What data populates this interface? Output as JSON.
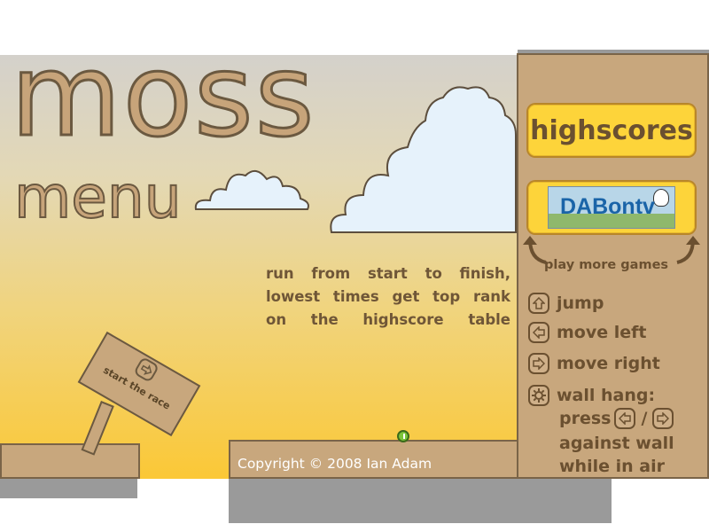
{
  "game": {
    "title": "moss",
    "subtitle": "menu"
  },
  "instructions": {
    "lines": [
      "run from start to finish,",
      "lowest times get top rank",
      "on the highscore table"
    ]
  },
  "sign": {
    "label": "start the race"
  },
  "copyright": "Copyright © 2008 Ian Adam",
  "sidebar": {
    "highscores_label": "highscores",
    "sponsor_label": "DABontv",
    "play_more_label": "play more games"
  },
  "controls": {
    "jump": "jump",
    "move_left": "move left",
    "move_right": "move right",
    "wall_hang_title": "wall hang:",
    "wall_hang_press": "press",
    "wall_hang_sep": "/",
    "wall_hang_line2": "against wall",
    "wall_hang_line3": "while in air"
  },
  "colors": {
    "sand": "#c8a77d",
    "button_yellow": "#fdd43a",
    "text_brown": "#6b5030",
    "player_green": "#7cc43a"
  }
}
